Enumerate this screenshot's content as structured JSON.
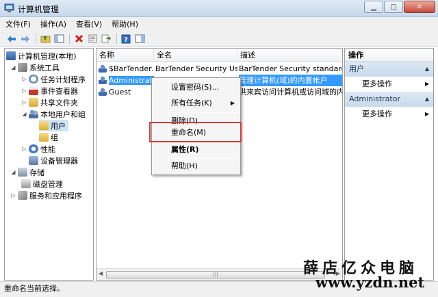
{
  "window": {
    "title": "计算机管理",
    "minimize": "▁",
    "maximize": "□",
    "close": "✕"
  },
  "menu": [
    "文件(F)",
    "操作(A)",
    "查看(V)",
    "帮助(H)"
  ],
  "toolbar": {
    "icons": [
      "back-arrow-icon",
      "forward-arrow-icon",
      "up-folder-icon",
      "show-tree-icon",
      "delete-icon",
      "properties-icon",
      "export-icon",
      "help-icon",
      "panel-icon"
    ]
  },
  "tree": {
    "root": "计算机管理(本地)",
    "system_tools": "系统工具",
    "task_scheduler": "任务计划程序",
    "event_viewer": "事件查看器",
    "shared_folders": "共享文件夹",
    "local_users": "本地用户和组",
    "users": "用户",
    "groups": "组",
    "performance": "性能",
    "device_manager": "设备管理器",
    "storage": "存储",
    "disk_management": "磁盘管理",
    "services": "服务和应用程序"
  },
  "list": {
    "columns": [
      "名称",
      "全名",
      "描述"
    ],
    "rows": [
      {
        "name": "$BarTender...",
        "fullname": "BarTender Security Us...",
        "desc": "BarTender Security standard u..."
      },
      {
        "name": "Administrat...",
        "fullname": "",
        "desc": "管理计算机(域)的内置帐户"
      },
      {
        "name": "Guest",
        "fullname": "",
        "desc": "供来宾访问计算机或访问域的内..."
      }
    ],
    "scroll_grip": "|||"
  },
  "context_menu": {
    "set_password": "设置密码(S)...",
    "all_tasks": "所有任务(K)",
    "delete": "删除(D)",
    "rename": "重命名(M)",
    "properties": "属性(R)",
    "help": "帮助(H)"
  },
  "actions": {
    "title": "操作",
    "sections": [
      {
        "label": "用户",
        "item": "更多操作"
      },
      {
        "label": "Administrator",
        "item": "更多操作"
      }
    ]
  },
  "status": "重命名当前选择。",
  "watermark": {
    "line1": "薛店亿众电脑",
    "line2": "www.yzdn.net"
  },
  "colors": {
    "selection": "#3399ff",
    "highlight_box": "#d23a3a",
    "tree_selection": "#cce4f7"
  }
}
